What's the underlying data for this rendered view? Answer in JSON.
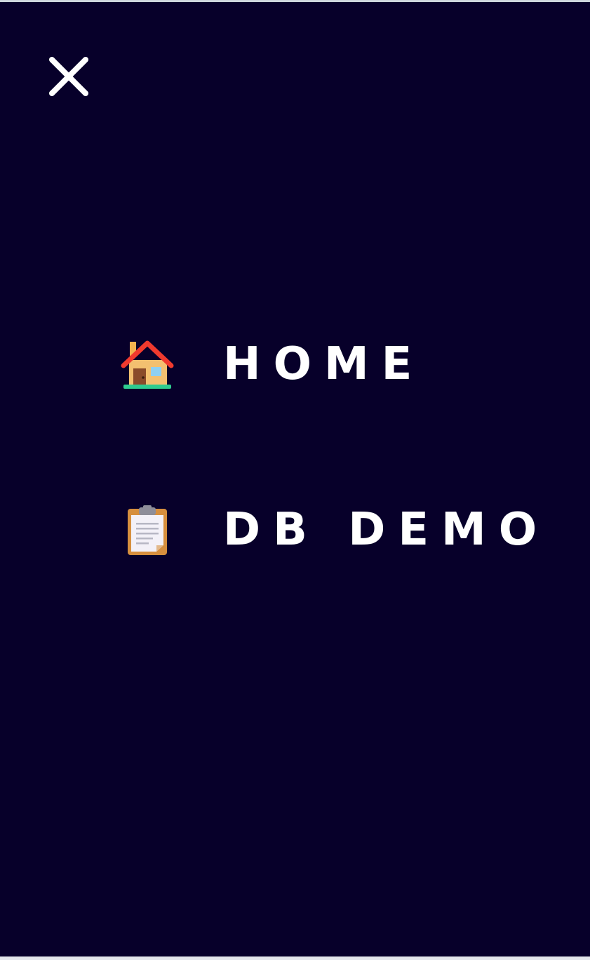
{
  "menu": {
    "close_icon": "close-icon",
    "items": [
      {
        "label": "HOME",
        "icon": "house-icon"
      },
      {
        "label": "DB DEMO",
        "icon": "clipboard-icon"
      }
    ]
  },
  "colors": {
    "background": "#07002a",
    "text": "#ffffff"
  }
}
